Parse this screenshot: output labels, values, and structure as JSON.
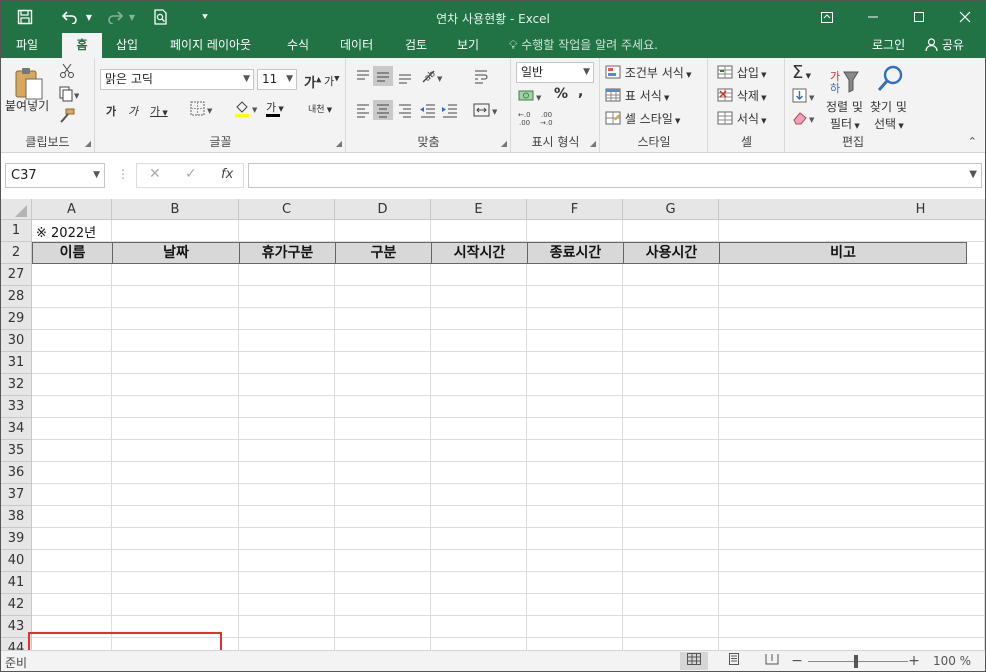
{
  "window": {
    "title": "연차 사용현황 - Excel",
    "icons": [
      "save-icon",
      "undo-icon",
      "redo-icon",
      "print-preview-icon",
      "customize-qat-icon"
    ]
  },
  "tabs": [
    "파일",
    "홈",
    "삽입",
    "페이지 레이아웃",
    "수식",
    "데이터",
    "검토",
    "보기"
  ],
  "active_tab": "홈",
  "tell_me": "수행할 작업을 알려 주세요.",
  "account": {
    "login": "로그인",
    "share": "공유"
  },
  "ribbon": {
    "clipboard": {
      "label": "클립보드",
      "paste": "붙여넣기"
    },
    "font": {
      "label": "글꼴",
      "font_name": "맑은 고딕",
      "font_size": "11",
      "grow": "가",
      "shrink": "가",
      "bold": "가",
      "italic": "가",
      "underline": "가",
      "font_color": "가",
      "phonetic": "내천"
    },
    "alignment": {
      "label": "맞춤"
    },
    "number": {
      "label": "표시 형식",
      "format": "일반",
      "percent": "%",
      "comma": ",",
      "inc_decimal": "←.0 .00",
      "dec_decimal": ".00 →.0"
    },
    "styles": {
      "label": "스타일",
      "conditional": "조건부 서식",
      "table": "표 서식",
      "cell_styles": "셀 스타일"
    },
    "cells": {
      "label": "셀",
      "insert": "삽입",
      "delete": "삭제",
      "format": "서식"
    },
    "editing": {
      "label": "편집",
      "sort1": "정렬 및",
      "sort2": "필터",
      "find1": "찾기 및",
      "find2": "선택"
    }
  },
  "formula_bar": {
    "name_box": "C37",
    "fx": "fx",
    "value": ""
  },
  "sheet": {
    "columns": [
      "A",
      "B",
      "C",
      "D",
      "E",
      "F",
      "G",
      "H"
    ],
    "a1": "※ 2022년",
    "headers": [
      "이름",
      "날짜",
      "휴가구분",
      "구분",
      "시작시간",
      "종료시간",
      "사용시간",
      "비고"
    ],
    "rows": [
      "1",
      "2",
      "27",
      "28",
      "29",
      "30",
      "31",
      "32",
      "33",
      "34",
      "35",
      "36",
      "37",
      "38",
      "39",
      "40",
      "41",
      "42",
      "43",
      "44"
    ]
  },
  "status_bar": {
    "ready": "준비",
    "zoom": "100 %",
    "zoom_out": "−",
    "zoom_in": "+"
  }
}
